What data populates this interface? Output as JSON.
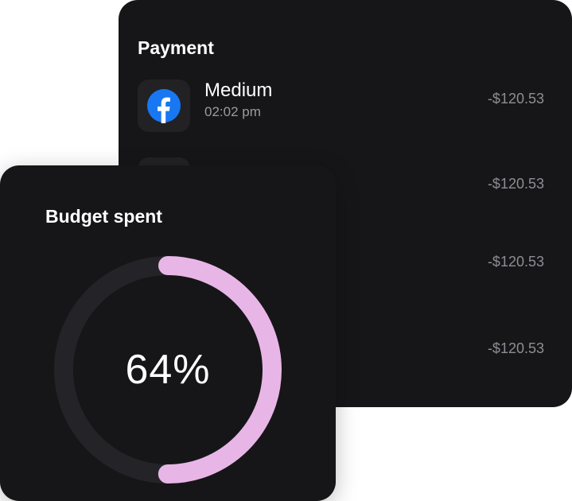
{
  "payment": {
    "title": "Payment",
    "transactions": [
      {
        "name": "Medium",
        "time": "02:02 pm",
        "amount": "-$120.53",
        "icon": "facebook-icon"
      },
      {
        "amount": "-$120.53"
      },
      {
        "amount": "-$120.53"
      },
      {
        "amount": "-$120.53"
      }
    ]
  },
  "budget": {
    "title": "Budget spent",
    "percent_label": "64%",
    "progress_fraction": 0.5
  },
  "colors": {
    "card_background": "#161618",
    "ring_track": "#242428",
    "ring_progress": "#e8b6e6",
    "facebook_blue": "#1877f2"
  }
}
